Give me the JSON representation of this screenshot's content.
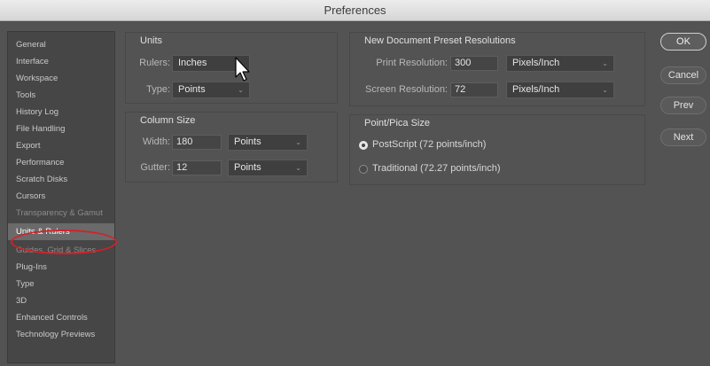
{
  "window": {
    "title": "Preferences"
  },
  "sidebar": {
    "items": [
      {
        "label": "General"
      },
      {
        "label": "Interface"
      },
      {
        "label": "Workspace"
      },
      {
        "label": "Tools"
      },
      {
        "label": "History Log"
      },
      {
        "label": "File Handling"
      },
      {
        "label": "Export"
      },
      {
        "label": "Performance"
      },
      {
        "label": "Scratch Disks"
      },
      {
        "label": "Cursors"
      },
      {
        "label": "Transparency & Gamut"
      },
      {
        "label": "Units & Rulers",
        "selected": true
      },
      {
        "label": "Guides, Grid & Slices"
      },
      {
        "label": "Plug-Ins"
      },
      {
        "label": "Type"
      },
      {
        "label": "3D"
      },
      {
        "label": "Enhanced Controls"
      },
      {
        "label": "Technology Previews"
      }
    ]
  },
  "units": {
    "title": "Units",
    "rulers_label": "Rulers:",
    "rulers_value": "Inches",
    "type_label": "Type:",
    "type_value": "Points"
  },
  "column_size": {
    "title": "Column Size",
    "width_label": "Width:",
    "width_value": "180",
    "width_unit": "Points",
    "gutter_label": "Gutter:",
    "gutter_value": "12",
    "gutter_unit": "Points"
  },
  "presets": {
    "title": "New Document Preset Resolutions",
    "print_label": "Print Resolution:",
    "print_value": "300",
    "print_unit": "Pixels/Inch",
    "screen_label": "Screen Resolution:",
    "screen_value": "72",
    "screen_unit": "Pixels/Inch"
  },
  "point_pica": {
    "title": "Point/Pica Size",
    "options": [
      {
        "label": "PostScript (72 points/inch)",
        "selected": true
      },
      {
        "label": "Traditional (72.27 points/inch)",
        "selected": false
      }
    ]
  },
  "buttons": {
    "ok": "OK",
    "cancel": "Cancel",
    "prev": "Prev",
    "next": "Next"
  },
  "annotation": {
    "color": "#d4202a"
  }
}
